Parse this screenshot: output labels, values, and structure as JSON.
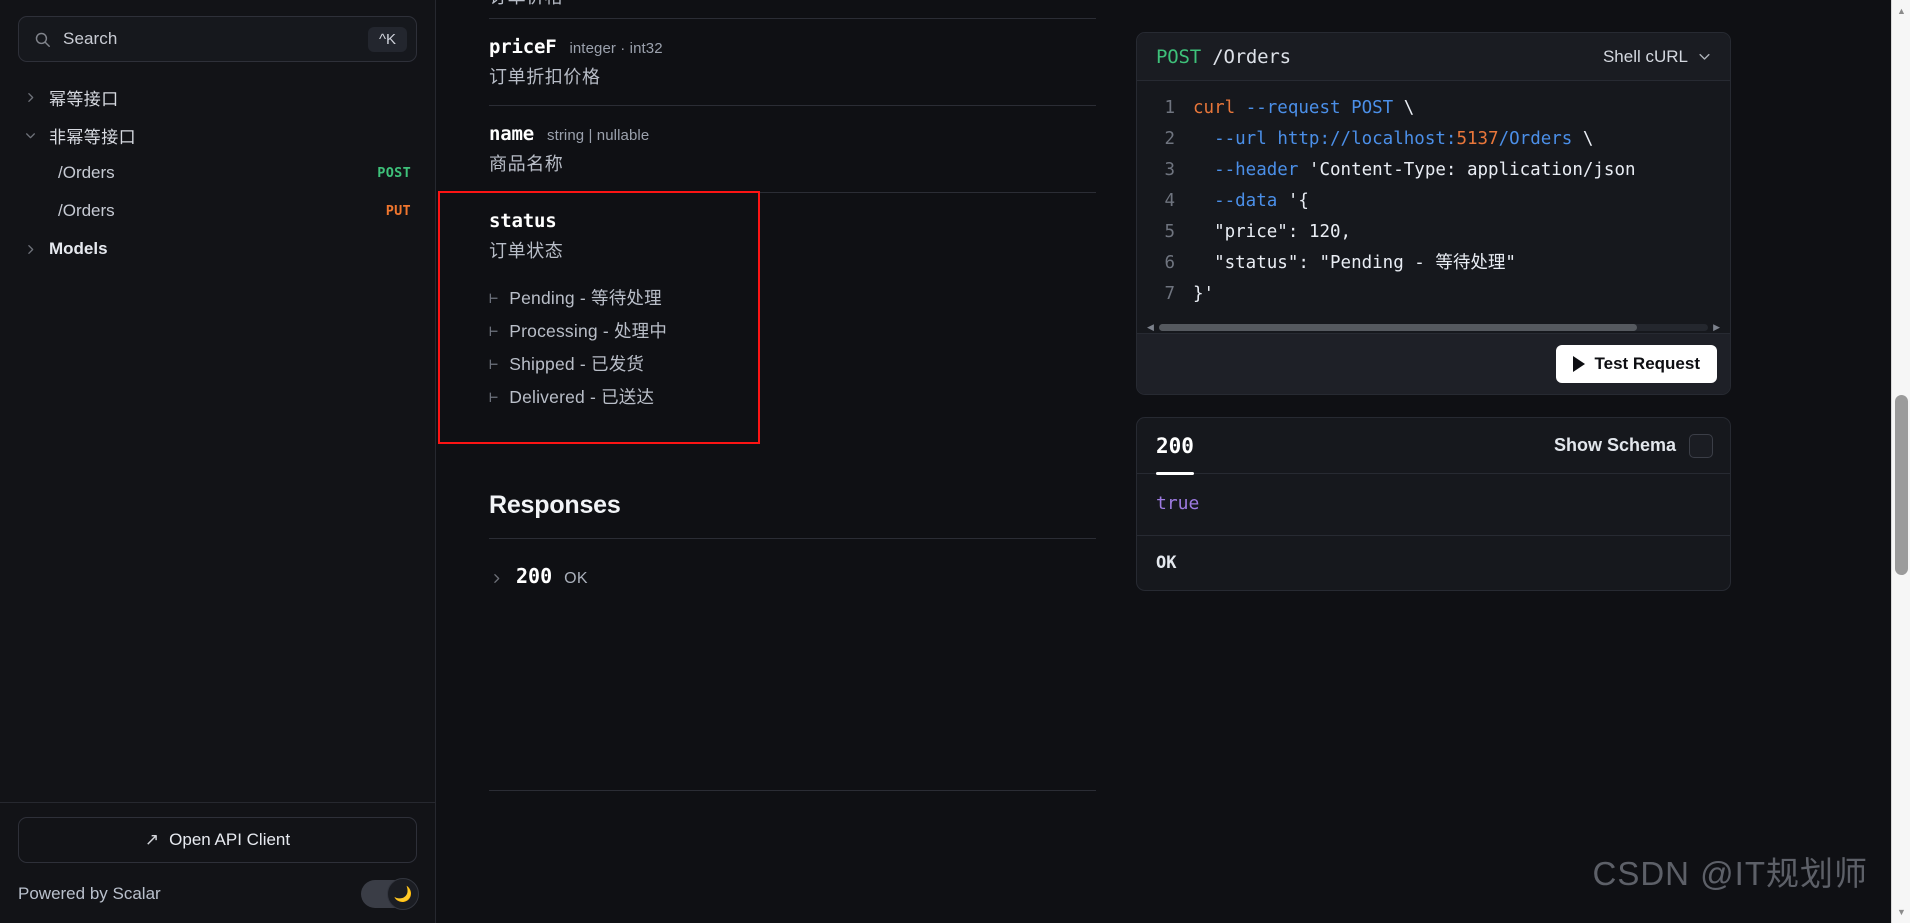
{
  "sidebar": {
    "search": {
      "placeholder": "Search",
      "shortcut": "^K",
      "icon": "search-icon"
    },
    "items": [
      {
        "label": "幂等接口",
        "type": "group",
        "expanded": false,
        "method": ""
      },
      {
        "label": "非幂等接口",
        "type": "group",
        "expanded": true,
        "method": ""
      },
      {
        "label": "/Orders",
        "type": "endpoint",
        "method": "POST",
        "method_color": "#3ec17a"
      },
      {
        "label": "/Orders",
        "type": "endpoint",
        "method": "PUT",
        "method_color": "#f0762e"
      },
      {
        "label": "Models",
        "type": "group",
        "expanded": false,
        "method": ""
      }
    ],
    "footer": {
      "open_client_label": "Open API Client",
      "open_client_icon": "arrow-up-right-icon",
      "powered_by": "Powered by Scalar",
      "theme_icon": "moon-icon"
    }
  },
  "document": {
    "clipped_top_desc": "订单价格",
    "fields": [
      {
        "name": "priceF",
        "type": "integer · int32",
        "description": "订单折扣价格",
        "enum": []
      },
      {
        "name": "name",
        "type": "string | nullable",
        "description": "商品名称",
        "enum": []
      },
      {
        "name": "status",
        "type": "",
        "description": "订单状态",
        "highlighted": true,
        "enum": [
          "Pending - 等待处理",
          "Processing - 处理中",
          "Shipped - 已发货",
          "Delivered - 已送达"
        ]
      }
    ],
    "responses_section": {
      "title": "Responses",
      "rows": [
        {
          "code": "200",
          "text": "OK"
        }
      ]
    }
  },
  "request_panel": {
    "method": "POST",
    "path": "/Orders",
    "language": "Shell cURL",
    "language_chevron": "chevron-down-icon",
    "code_lines": [
      {
        "n": "1",
        "text": "curl --request POST \\"
      },
      {
        "n": "2",
        "text": "  --url http://localhost:5137/Orders \\"
      },
      {
        "n": "3",
        "text": "  --header 'Content-Type: application/json' \\"
      },
      {
        "n": "4",
        "text": "  --data '{"
      },
      {
        "n": "5",
        "text": "  \"price\": 120,"
      },
      {
        "n": "6",
        "text": "  \"status\": \"Pending - 等待处理\""
      },
      {
        "n": "7",
        "text": "}'"
      }
    ],
    "test_button": "Test Request",
    "test_button_icon": "play-icon"
  },
  "response_panel": {
    "status": "200",
    "show_schema_label": "Show Schema",
    "body": "true",
    "footer": "OK"
  },
  "watermark": "CSDN @IT规划师",
  "colors": {
    "accent_red_highlight": "#fc1414",
    "method_post": "#3ec17a",
    "method_put": "#f0762e",
    "code_string": "#e9edf4",
    "code_flag": "#4b8fe8",
    "code_command": "#e8763a",
    "code_number": "#e8763a",
    "response_value": "#9d7ae0",
    "background": "#0f1014",
    "panel_background": "#16181d"
  }
}
